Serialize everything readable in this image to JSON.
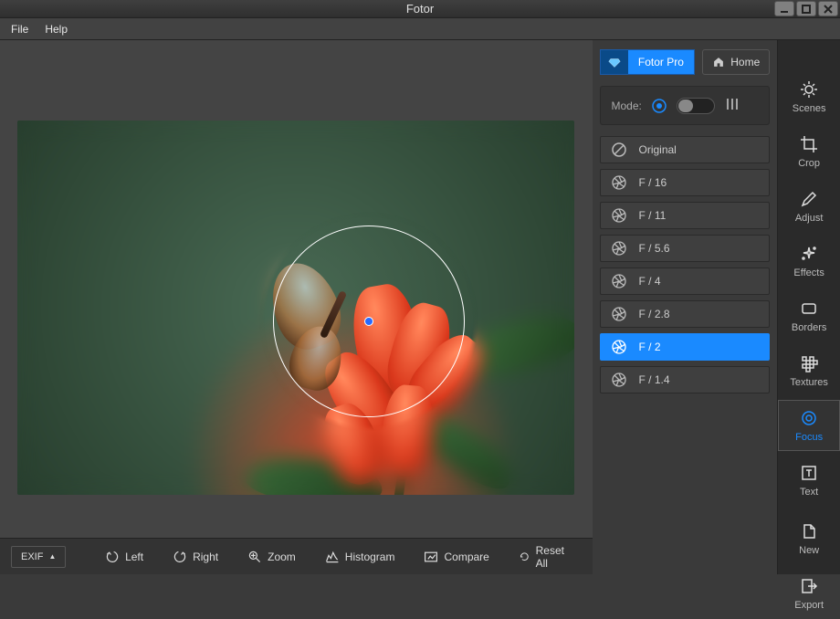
{
  "app": {
    "title": "Fotor"
  },
  "menu": {
    "file": "File",
    "help": "Help"
  },
  "pro_button": "Fotor Pro",
  "home_button": "Home",
  "mode": {
    "label": "Mode:"
  },
  "apertures": [
    {
      "label": "Original",
      "icon": "none"
    },
    {
      "label": "F / 16",
      "icon": "aperture"
    },
    {
      "label": "F / 11",
      "icon": "aperture"
    },
    {
      "label": "F / 5.6",
      "icon": "aperture"
    },
    {
      "label": "F / 4",
      "icon": "aperture"
    },
    {
      "label": "F / 2.8",
      "icon": "aperture"
    },
    {
      "label": "F / 2",
      "icon": "aperture",
      "selected": true
    },
    {
      "label": "F / 1.4",
      "icon": "aperture"
    }
  ],
  "sidebar": [
    {
      "label": "Scenes",
      "icon": "brightness"
    },
    {
      "label": "Crop",
      "icon": "crop"
    },
    {
      "label": "Adjust",
      "icon": "pencil"
    },
    {
      "label": "Effects",
      "icon": "sparkle"
    },
    {
      "label": "Borders",
      "icon": "rect"
    },
    {
      "label": "Textures",
      "icon": "checker"
    },
    {
      "label": "Focus",
      "icon": "target",
      "selected": true
    },
    {
      "label": "Text",
      "icon": "text"
    },
    {
      "label": "New",
      "icon": "new",
      "gap_before": true
    },
    {
      "label": "Export",
      "icon": "export"
    }
  ],
  "toolbar": {
    "exif": "EXIF",
    "left": "Left",
    "right": "Right",
    "zoom": "Zoom",
    "histogram": "Histogram",
    "compare": "Compare",
    "reset": "Reset All"
  }
}
